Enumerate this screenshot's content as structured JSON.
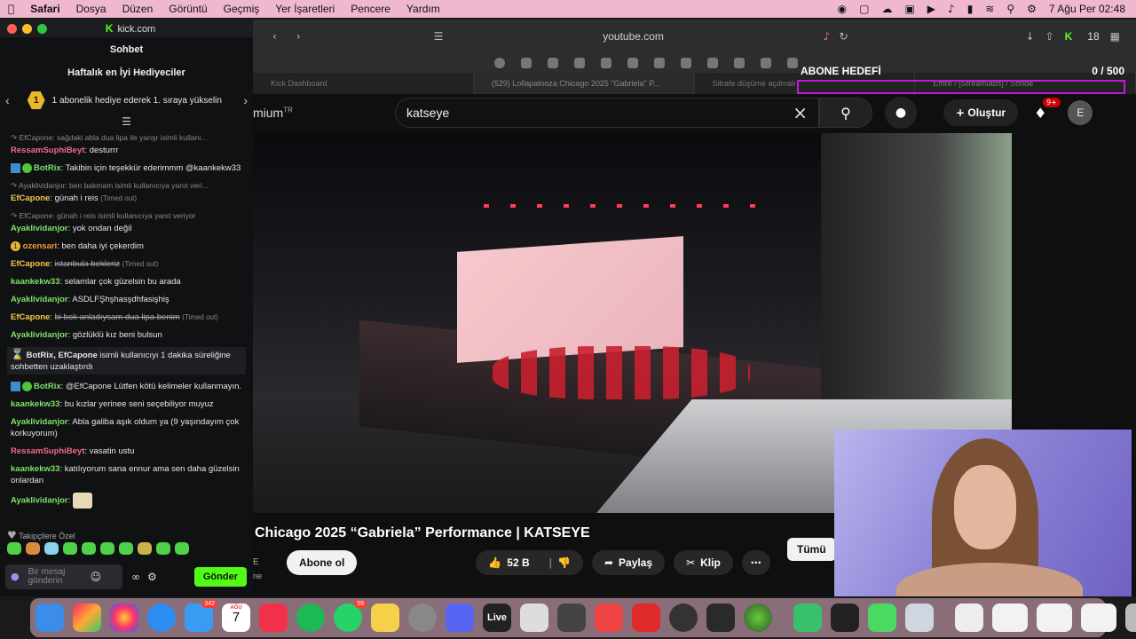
{
  "menubar": {
    "app": "Safari",
    "items": [
      "Dosya",
      "Düzen",
      "Görüntü",
      "Geçmiş",
      "Yer İşaretleri",
      "Pencere",
      "Yardım"
    ],
    "clock": "7 Ağu Per  02:48"
  },
  "chat": {
    "site": "kick.com",
    "title": "Sohbet",
    "leaderboard_title": "Haftalık en İyi Hediyeciler",
    "leaderboard_rank": "1",
    "leaderboard_text": "1 abonelik hediye ederek 1. sıraya yükselin",
    "messages": [
      {
        "type": "reply",
        "text": "EfCapone: sağdaki abla dua lipa ile yarışr isimli kullanı..."
      },
      {
        "user": "RessamSuphiBeyt",
        "color": "pink",
        "text": "desturrr"
      },
      {
        "user": "BotRix",
        "color": "green",
        "bot": true,
        "text": "Takibin için teşekkür ederimmm @kaankekw33"
      },
      {
        "type": "reply",
        "text": "Ayaklividanjor: ben bakmam isimli kullanıcıya yanıt veri..."
      },
      {
        "user": "EfCapone",
        "color": "yellow",
        "text": "günah i reis",
        "timeout": "(Timed out)"
      },
      {
        "type": "reply",
        "text": "EfCapone: günah i reis isimli kullanıcıya yanıt veriyor"
      },
      {
        "user": "Ayaklividanjor",
        "color": "green",
        "text": "yok ondan değil"
      },
      {
        "user": "ozensari",
        "color": "orange",
        "badge": "1",
        "text": "ben daha iyi çekerdim"
      },
      {
        "user": "EfCapone",
        "color": "yellow",
        "strike": true,
        "text": "istanbula bekleriz",
        "timeout": "(Timed out)"
      },
      {
        "user": "kaankekw33",
        "color": "green",
        "text": "selamlar çok güzelsin bu arada"
      },
      {
        "user": "Ayaklividanjor",
        "color": "green",
        "text": "ASDLFŞhşhasşdhfasişhiş"
      },
      {
        "user": "EfCapone",
        "color": "yellow",
        "strike": true,
        "text": "bi bok anladıysam dua lipa benim",
        "timeout": "(Timed out)"
      },
      {
        "user": "Ayaklividanjor",
        "color": "green",
        "text": "gözlüklü kız beni bulsun"
      },
      {
        "type": "system",
        "user": "BotRix, EfCapone",
        "text": "isimli kullanıcıyı 1 dakika süreliğine sohbetten uzaklaştırdı"
      },
      {
        "user": "BotRix",
        "color": "green",
        "bot": true,
        "text": "@EfCapone Lütfen kötü kelimeler kullanmayın."
      },
      {
        "user": "kaankekw33",
        "color": "green",
        "text": "bu kızlar yerinee seni seçebiliyor muyuz"
      },
      {
        "user": "Ayaklividanjor",
        "color": "green",
        "text": "Abla galiba aşık oldum ya (9 yaşındayım çok korkuyorum)"
      },
      {
        "user": "RessamSuphiBeyt",
        "color": "pink",
        "text": "vasatin ustu"
      },
      {
        "user": "kaankekw33",
        "color": "green",
        "text": "katılıyorum sana ennur ama sen daha güzelsin onlardan"
      },
      {
        "user": "Ayaklividanjor",
        "color": "green",
        "text": "",
        "sticker": true
      }
    ],
    "followers_label": "Takipçilere Özel",
    "input_placeholder": "Bir mesaj gönderin",
    "send_label": "Gönder"
  },
  "browser": {
    "url": "youtube.com",
    "k_count": "18",
    "tabs": [
      "Kick Dashboard",
      "(529) Lollapalooza Chicago 2025 \"Gabriela\" P...",
      "Sitrafe düşüme açılmalı",
      "Emre / [Streamlabs] / Sonde"
    ]
  },
  "overlay": {
    "goal_label": "ABONE HEDEFİ",
    "goal_current": "0",
    "goal_target": "/ 500",
    "goal_progress": 0
  },
  "youtube": {
    "brand": "mium",
    "brand_sup": "TR",
    "search_value": "katseye",
    "create_label": "Oluştur",
    "notif_count": "9+",
    "avatar_letter": "E",
    "video_title": "Chicago 2025 “Gabriela” Performance | KATSEYE",
    "subscribe_label": "Abone ol",
    "likes": "52 B",
    "share_label": "Paylaş",
    "clip_label": "Klip",
    "all_label": "Tümü",
    "channel_fragment": "E",
    "channel_sub": "ne"
  },
  "dock": {
    "mail_badge": "342",
    "calendar_month": "AĞU",
    "calendar_day": "7",
    "whatsapp_badge": "59",
    "live_label": "Live"
  }
}
